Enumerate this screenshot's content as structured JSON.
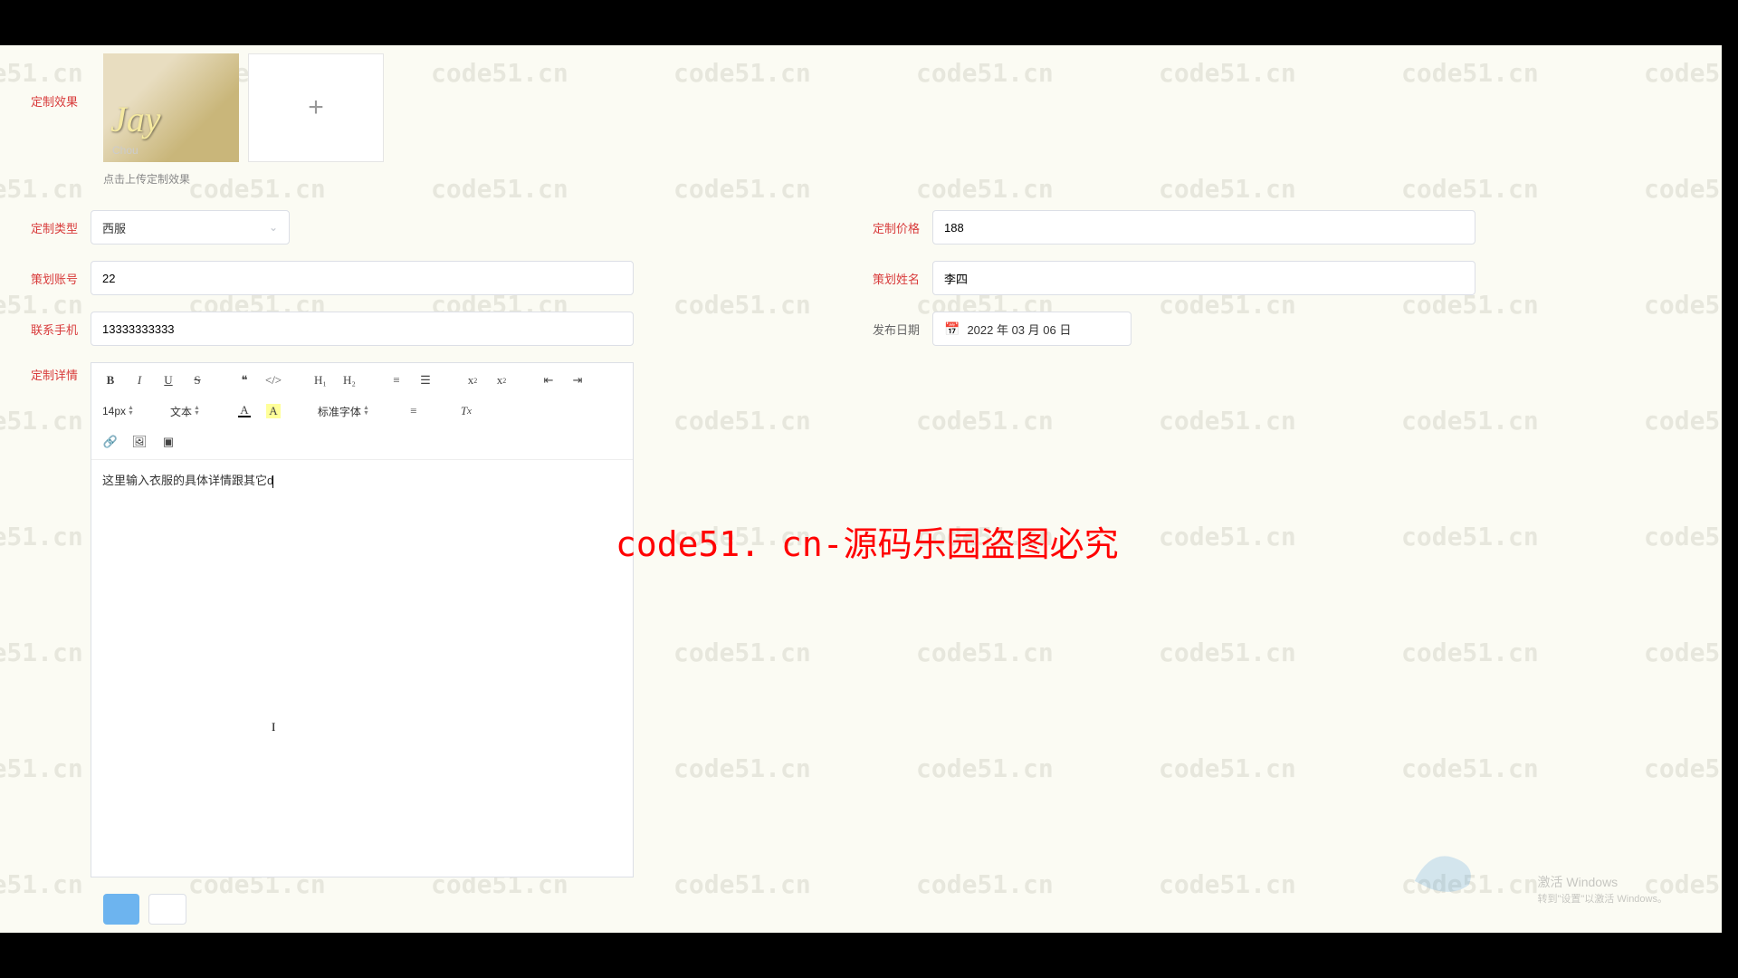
{
  "watermark_text": "code51.cn",
  "big_watermark": "code51. cn-源码乐园盗图必究",
  "labels": {
    "custom_effect": "定制效果",
    "custom_type": "定制类型",
    "custom_price": "定制价格",
    "plan_account": "策划账号",
    "plan_name": "策划姓名",
    "contact_phone": "联系手机",
    "publish_date": "发布日期",
    "custom_detail": "定制详情"
  },
  "values": {
    "custom_type": "西服",
    "custom_price": "188",
    "plan_account": "22",
    "plan_name": "李四",
    "contact_phone": "13333333333",
    "publish_date": "2022 年 03 月 06 日",
    "editor_text": "这里输入衣服的具体详情跟其它d"
  },
  "upload_hint": "点击上传定制效果",
  "thumb": {
    "line1": "Jay",
    "line2": "Chou"
  },
  "toolbar": {
    "font_size": "14px",
    "block": "文本",
    "font_family": "标准字体"
  },
  "activate": {
    "l1": "激活 Windows",
    "l2": "转到\"设置\"以激活 Windows。"
  }
}
